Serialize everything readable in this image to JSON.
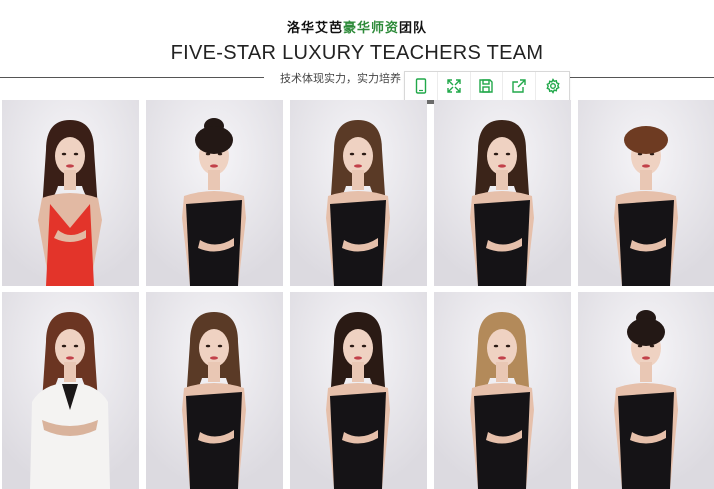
{
  "header": {
    "title_cn_part1": "洛华艾芭",
    "title_cn_accent": "豪华师资",
    "title_cn_part2": "团队",
    "title_en": "FIVE-STAR LUXURY TEACHERS TEAM",
    "subtitle": "技术体现实力，实力培养"
  },
  "toolbar": {
    "icons": [
      "mobile-icon",
      "expand-icon",
      "save-icon",
      "share-icon",
      "settings-icon"
    ],
    "accent_color": "#21a84a"
  },
  "colors": {
    "title_accent": "#2e8b3a",
    "photo_background": "#e9e7ec",
    "dress_black": "#151316",
    "dress_red": "#e3342a",
    "jacket_white": "#f4f3f2"
  },
  "gallery": {
    "rows": 2,
    "columns": 5,
    "photos": [
      {
        "outfit": "red-dress",
        "hair": "dark-brown"
      },
      {
        "outfit": "black-dress",
        "hair": "dark-updo"
      },
      {
        "outfit": "black-dress",
        "hair": "brown-wavy"
      },
      {
        "outfit": "black-dress",
        "hair": "dark-brown-long"
      },
      {
        "outfit": "black-dress",
        "hair": "short-auburn"
      },
      {
        "outfit": "white-jacket",
        "hair": "auburn-long"
      },
      {
        "outfit": "black-dress",
        "hair": "brown-wavy"
      },
      {
        "outfit": "black-dress",
        "hair": "dark-long"
      },
      {
        "outfit": "black-dress",
        "hair": "blonde-wavy"
      },
      {
        "outfit": "black-dress",
        "hair": "dark-updo"
      }
    ]
  }
}
